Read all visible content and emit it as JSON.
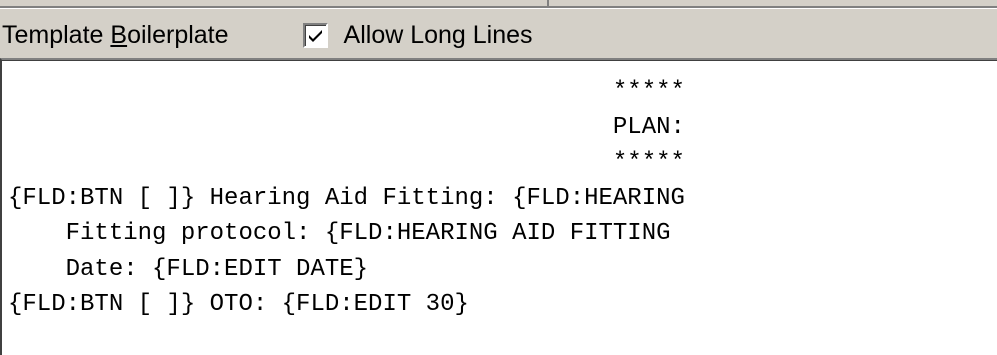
{
  "toolbar": {
    "boilerplate_label_pre": "Template ",
    "boilerplate_label_accel": "B",
    "boilerplate_label_post": "oilerplate",
    "allow_long_lines_label": "Allow Long Lines",
    "allow_long_lines_checked": true
  },
  "editor": {
    "lines": [
      "                                          *****",
      "                                          PLAN:",
      "                                          *****",
      "{FLD:BTN [ ]} Hearing Aid Fitting: {FLD:HEARING",
      "    Fitting protocol: {FLD:HEARING AID FITTING",
      "    Date: {FLD:EDIT DATE}",
      "{FLD:BTN [ ]} OTO: {FLD:EDIT 30}"
    ]
  }
}
